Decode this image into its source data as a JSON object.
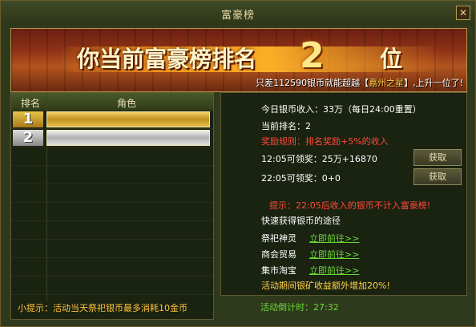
{
  "window": {
    "title": "富豪榜",
    "close_glyph": "✕"
  },
  "banner": {
    "headline": "你当前富豪榜排名",
    "rank": "2",
    "position_suffix": "位",
    "note_prefix": "只差112590银币就能超越【",
    "note_name": "嘉州之星",
    "note_suffix": "】,上升一位了!"
  },
  "table": {
    "columns": [
      "排名",
      "角色"
    ],
    "rows": [
      {
        "rank": "1",
        "name": ""
      },
      {
        "rank": "2",
        "name": ""
      }
    ]
  },
  "tip": "小提示：活动当天祭祀银币最多消耗10金币",
  "info": {
    "income_today": "今日银币收入：33万（每日24:00重置）",
    "current_rank": "当前排名：2",
    "reward_rule": "奖励规则：排名奖励+5%的收入",
    "claim1": "12:05可领奖：25万+16870",
    "claim2": "22:05可领奖：0+0",
    "claim_button": "获取",
    "warning": "提示：22:05后收入的银币不计入富豪榜!",
    "quick_title": "快速获得银币的途径",
    "routes": [
      {
        "label": "祭祀神灵",
        "link": "立即前往>>"
      },
      {
        "label": "商会贸易",
        "link": "立即前往>>"
      },
      {
        "label": "集市淘宝",
        "link": "立即前往>>"
      }
    ],
    "bonus": "活动期间银矿收益额外增加20%!",
    "countdown": "活动倒计时：27:32"
  }
}
